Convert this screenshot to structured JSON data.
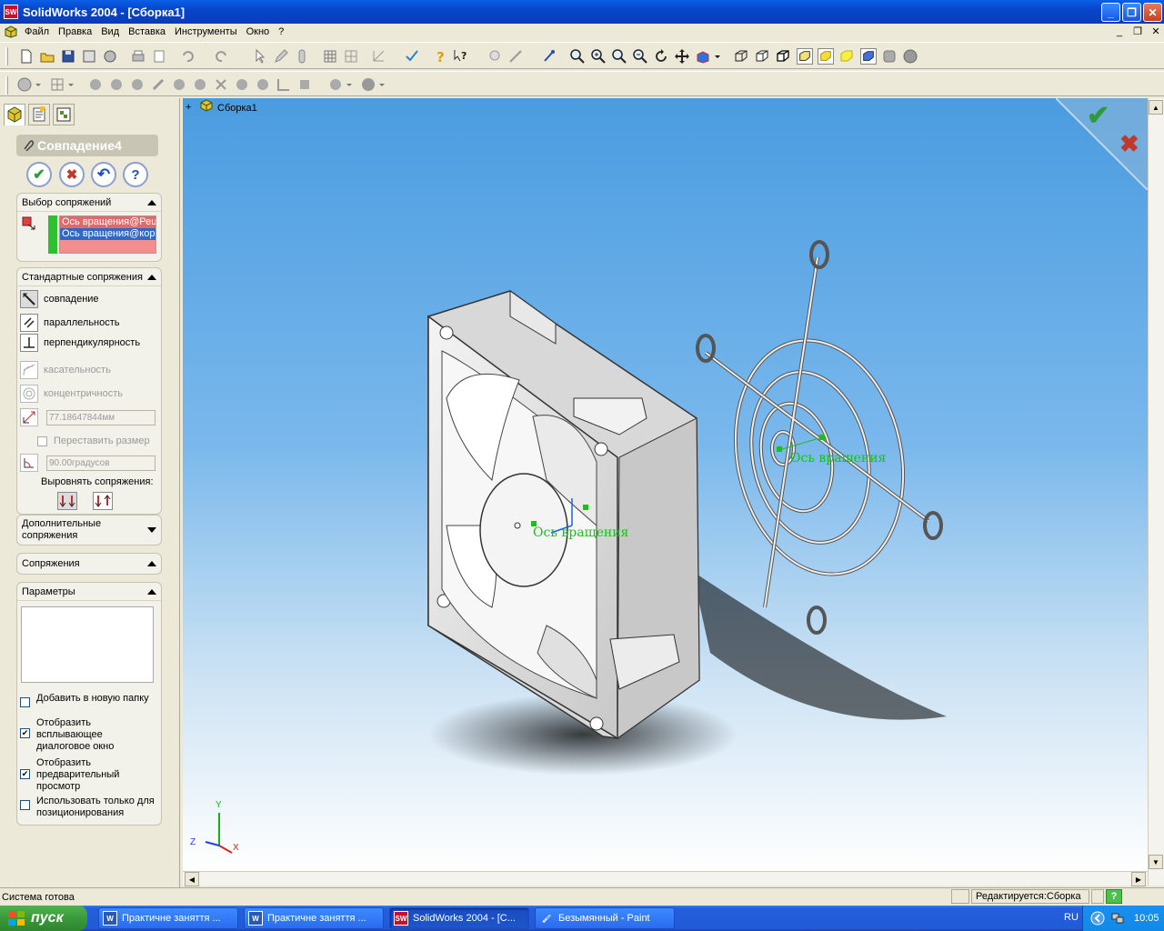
{
  "window": {
    "app_badge": "SW",
    "title": "SolidWorks 2004 - [Сборка1]",
    "min": "_",
    "max": "❐",
    "close": "✕"
  },
  "menu": [
    "Файл",
    "Правка",
    "Вид",
    "Вставка",
    "Инструменты",
    "Окно",
    "?"
  ],
  "mdi": {
    "min": "_",
    "restore": "❐",
    "close": "✕"
  },
  "tree": {
    "expand": "+",
    "root": "Сборка1"
  },
  "mate_panel": {
    "title": "Совпадение4",
    "buttons": {
      "ok": "✔",
      "cancel": "✖",
      "undo": "↶",
      "help": "?"
    },
    "selection": {
      "header": "Выбор сопряжений",
      "items": [
        "Ось вращения@Рец",
        "Ось вращения@кор"
      ]
    },
    "standard": {
      "header": "Стандартные сопряжения",
      "items": [
        {
          "label": "совпадение",
          "enabled": true
        },
        {
          "label": "параллельность",
          "enabled": true
        },
        {
          "label": "перпендикулярность",
          "enabled": true
        },
        {
          "label": "касательность",
          "enabled": false
        },
        {
          "label": "концентричность",
          "enabled": false
        }
      ],
      "distance": "77.18647844мм",
      "flip_label": "Переставить размер",
      "angle": "90.00градусов",
      "align_label": "Выровнять сопряжения:"
    },
    "advanced": {
      "header": "Дополнительные сопряжения"
    },
    "mates": {
      "header": "Сопряжения"
    },
    "params": {
      "header": "Параметры"
    },
    "options": [
      {
        "label": "Добавить в новую папку",
        "checked": false
      },
      {
        "label": "Отобразить всплывающее диалоговое окно",
        "checked": true
      },
      {
        "label": "Отобразить предварительный просмотр",
        "checked": true
      },
      {
        "label": "Использовать только для позиционирования",
        "checked": false
      }
    ]
  },
  "viewport": {
    "fan_axis_label": "Ось вращения",
    "grill_axis_label": "Ось вращения",
    "confirm_ok": "✔",
    "confirm_cancel": "✖",
    "triad": {
      "x": "X",
      "y": "Y",
      "z": "Z"
    }
  },
  "status": {
    "left": "Система готова",
    "mode": "Редактируется:Сборка",
    "help": "?"
  },
  "taskbar": {
    "start": "пуск",
    "tasks": [
      {
        "icon": "W",
        "label": "Практичне заняття ...",
        "active": false
      },
      {
        "icon": "W",
        "label": "Практичне заняття ...",
        "active": false
      },
      {
        "icon": "SW",
        "label": "SolidWorks 2004 - [С...",
        "active": true
      },
      {
        "icon": "🖌",
        "label": "Безымянный - Paint",
        "active": false
      }
    ],
    "lang": "RU",
    "clock": "10:05"
  },
  "colors": {
    "accent": "#0a5fe8",
    "sel_red": "#f2b0b0",
    "sel_blue": "#3168c6",
    "ok_green": "#2e9a3c",
    "cancel_red": "#c0392b",
    "axis_green": "#18c018"
  }
}
